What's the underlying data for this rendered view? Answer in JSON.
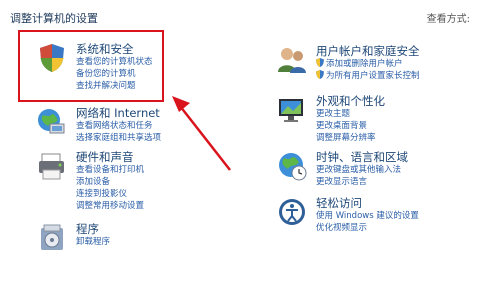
{
  "page": {
    "title": "调整计算机的设置",
    "view_by_label": "查看方式:"
  },
  "left_categories": [
    {
      "icon": "shield-icon",
      "title": "系统和安全",
      "links": [
        "查看您的计算机状态",
        "备份您的计算机",
        "查找并解决问题"
      ]
    },
    {
      "icon": "network-icon",
      "title": "网络和 Internet",
      "links": [
        "查看网络状态和任务",
        "选择家庭组和共享选项"
      ]
    },
    {
      "icon": "printer-icon",
      "title": "硬件和声音",
      "links": [
        "查看设备和打印机",
        "添加设备",
        "连接到投影仪",
        "调整常用移动设置"
      ]
    },
    {
      "icon": "programs-icon",
      "title": "程序",
      "links": [
        "卸载程序"
      ]
    }
  ],
  "right_categories": [
    {
      "icon": "users-icon",
      "title": "用户帐户和家庭安全",
      "links": [
        "添加或删除用户帐户",
        "为所有用户设置家长控制"
      ],
      "shield_links": [
        true,
        true
      ]
    },
    {
      "icon": "display-icon",
      "title": "外观和个性化",
      "links": [
        "更改主题",
        "更改桌面背景",
        "调整屏幕分辨率"
      ]
    },
    {
      "icon": "globe-icon",
      "title": "时钟、语言和区域",
      "links": [
        "更改键盘或其他输入法",
        "更改显示语言"
      ]
    },
    {
      "icon": "ease-of-access-icon",
      "title": "轻松访问",
      "links": [
        "使用 Windows 建议的设置",
        "优化视频显示"
      ]
    }
  ],
  "colors": {
    "title": "#1e4877",
    "link": "#2a5ea7",
    "highlight": "#d9141c"
  }
}
